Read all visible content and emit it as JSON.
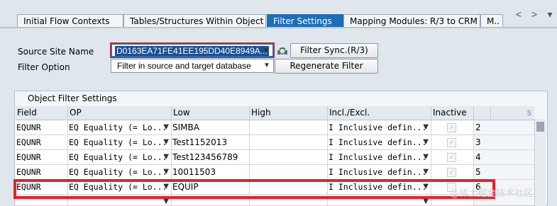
{
  "tabs": [
    {
      "label": "Initial Flow Contexts",
      "active": false
    },
    {
      "label": "Tables/Structures Within Object",
      "active": false
    },
    {
      "label": "Filter Settings",
      "active": true
    },
    {
      "label": "Mapping Modules: R/3 to CRM",
      "active": false
    },
    {
      "label": "M..",
      "active": false
    }
  ],
  "tab_nav": {
    "prev": "<",
    "next": ">",
    "menu": "▾"
  },
  "form": {
    "source_site_label": "Source Site Name",
    "source_site_value": "D0163EA71FE41EE195DD40E8949A...",
    "filter_option_label": "Filter Option",
    "filter_option_value": "Filter in source and target database",
    "filter_sync_button": "Filter Sync.(R/3)",
    "regenerate_button": "Regenerate Filter"
  },
  "group": {
    "title": "Object Filter Settings",
    "columns": [
      "Field",
      "OP",
      "Low",
      "High",
      "Incl./Excl.",
      "Inactive",
      "",
      "s"
    ],
    "rows": [
      {
        "field": "EQUNR",
        "op": "EQ Equality (= Lo...",
        "low": "SIMBA",
        "high": "",
        "incl": "I Inclusive defin...",
        "num": "2"
      },
      {
        "field": "EQUNR",
        "op": "EQ Equality (= Lo...",
        "low": "Test1152013",
        "high": "",
        "incl": "I Inclusive defin...",
        "num": "3"
      },
      {
        "field": "EQUNR",
        "op": "EQ Equality (= Lo...",
        "low": "Test123456789",
        "high": "",
        "incl": "I Inclusive defin...",
        "num": "4"
      },
      {
        "field": "EQUNR",
        "op": "EQ Equality (= Lo...",
        "low": "10011503",
        "high": "",
        "incl": "I Inclusive defin...",
        "num": "5"
      },
      {
        "field": "EQUNR",
        "op": "EQ Equality (= Lo...",
        "low": "EQUIP",
        "high": "",
        "incl": "I Inclusive defin...",
        "num": "6"
      }
    ]
  },
  "watermark": "@稀土掘金技术社区",
  "colors": {
    "active_tab": "#1d6fb8",
    "highlight_border": "#e8202a"
  }
}
